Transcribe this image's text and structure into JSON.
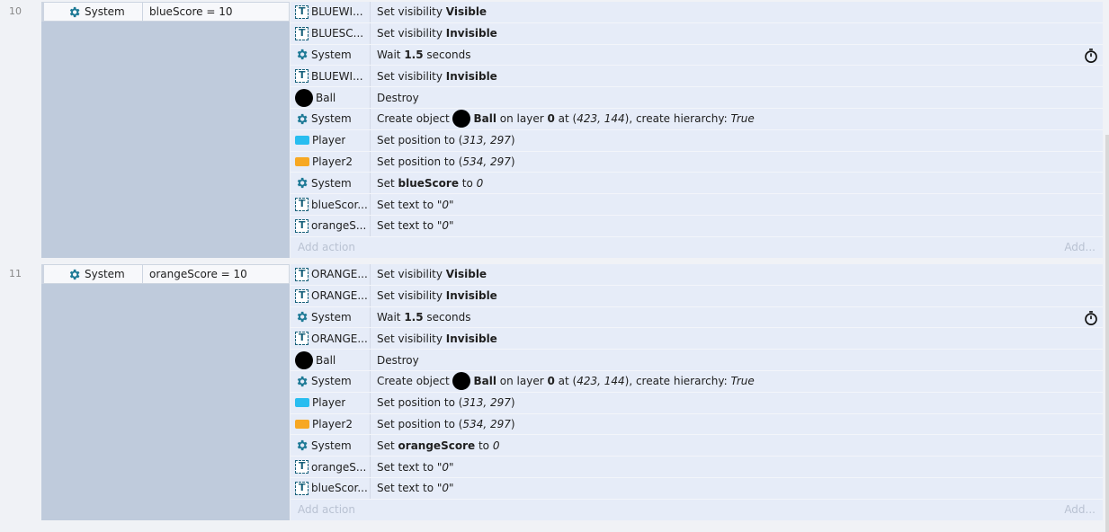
{
  "events": [
    {
      "number": "10",
      "condition": {
        "object": "System",
        "text": "blueScore = 10"
      },
      "actions": [
        {
          "icon": "text-icon",
          "object": "BLUEWI...",
          "parts": [
            {
              "t": "Set visibility "
            },
            {
              "t": "Visible",
              "b": true
            }
          ]
        },
        {
          "icon": "text-icon",
          "object": "BLUESC...",
          "parts": [
            {
              "t": "Set visibility "
            },
            {
              "t": "Invisible",
              "b": true
            }
          ]
        },
        {
          "icon": "gear-icon",
          "object": "System",
          "parts": [
            {
              "t": "Wait "
            },
            {
              "t": "1.5",
              "b": true
            },
            {
              "t": " seconds"
            }
          ],
          "timer": true
        },
        {
          "icon": "text-icon",
          "object": "BLUEWI...",
          "parts": [
            {
              "t": "Set visibility "
            },
            {
              "t": "Invisible",
              "b": true
            }
          ]
        },
        {
          "icon": "ball-icon",
          "object": "Ball",
          "parts": [
            {
              "t": "Destroy"
            }
          ]
        },
        {
          "icon": "gear-icon",
          "object": "System",
          "parts": [
            {
              "t": "Create object "
            },
            {
              "ball": true
            },
            {
              "t": "Ball",
              "b": true
            },
            {
              "t": " on layer "
            },
            {
              "t": "0",
              "b": true
            },
            {
              "t": " at ("
            },
            {
              "t": "423, 144",
              "i": true
            },
            {
              "t": "), create hierarchy: "
            },
            {
              "t": "True",
              "i": true
            }
          ]
        },
        {
          "icon": "player-icon",
          "object": "Player",
          "parts": [
            {
              "t": "Set position to ("
            },
            {
              "t": "313, 297",
              "i": true
            },
            {
              "t": ")"
            }
          ]
        },
        {
          "icon": "player2-icon",
          "object": "Player2",
          "parts": [
            {
              "t": "Set position to ("
            },
            {
              "t": "534, 297",
              "i": true
            },
            {
              "t": ")"
            }
          ]
        },
        {
          "icon": "gear-icon",
          "object": "System",
          "parts": [
            {
              "t": "Set "
            },
            {
              "t": "blueScore",
              "b": true
            },
            {
              "t": " to "
            },
            {
              "t": "0",
              "i": true
            }
          ]
        },
        {
          "icon": "text-icon",
          "object": "blueScor...",
          "parts": [
            {
              "t": "Set text to \""
            },
            {
              "t": "0",
              "i": true
            },
            {
              "t": "\""
            }
          ]
        },
        {
          "icon": "text-icon",
          "object": "orangeS...",
          "parts": [
            {
              "t": "Set text to \""
            },
            {
              "t": "0",
              "i": true
            },
            {
              "t": "\""
            }
          ]
        }
      ]
    },
    {
      "number": "11",
      "condition": {
        "object": "System",
        "text": "orangeScore = 10"
      },
      "actions": [
        {
          "icon": "text-icon",
          "object": "ORANGE...",
          "parts": [
            {
              "t": "Set visibility "
            },
            {
              "t": "Visible",
              "b": true
            }
          ]
        },
        {
          "icon": "text-icon",
          "object": "ORANGE...",
          "parts": [
            {
              "t": "Set visibility "
            },
            {
              "t": "Invisible",
              "b": true
            }
          ]
        },
        {
          "icon": "gear-icon",
          "object": "System",
          "parts": [
            {
              "t": "Wait "
            },
            {
              "t": "1.5",
              "b": true
            },
            {
              "t": " seconds"
            }
          ],
          "timer": true
        },
        {
          "icon": "text-icon",
          "object": "ORANGE...",
          "parts": [
            {
              "t": "Set visibility "
            },
            {
              "t": "Invisible",
              "b": true
            }
          ]
        },
        {
          "icon": "ball-icon",
          "object": "Ball",
          "parts": [
            {
              "t": "Destroy"
            }
          ]
        },
        {
          "icon": "gear-icon",
          "object": "System",
          "parts": [
            {
              "t": "Create object "
            },
            {
              "ball": true
            },
            {
              "t": "Ball",
              "b": true
            },
            {
              "t": " on layer "
            },
            {
              "t": "0",
              "b": true
            },
            {
              "t": " at ("
            },
            {
              "t": "423, 144",
              "i": true
            },
            {
              "t": "), create hierarchy: "
            },
            {
              "t": "True",
              "i": true
            }
          ]
        },
        {
          "icon": "player-icon",
          "object": "Player",
          "parts": [
            {
              "t": "Set position to ("
            },
            {
              "t": "313, 297",
              "i": true
            },
            {
              "t": ")"
            }
          ]
        },
        {
          "icon": "player2-icon",
          "object": "Player2",
          "parts": [
            {
              "t": "Set position to ("
            },
            {
              "t": "534, 297",
              "i": true
            },
            {
              "t": ")"
            }
          ]
        },
        {
          "icon": "gear-icon",
          "object": "System",
          "parts": [
            {
              "t": "Set "
            },
            {
              "t": "orangeScore",
              "b": true
            },
            {
              "t": " to "
            },
            {
              "t": "0",
              "i": true
            }
          ]
        },
        {
          "icon": "text-icon",
          "object": "orangeS...",
          "parts": [
            {
              "t": "Set text to \""
            },
            {
              "t": "0",
              "i": true
            },
            {
              "t": "\""
            }
          ]
        },
        {
          "icon": "text-icon",
          "object": "blueScor...",
          "parts": [
            {
              "t": "Set text to \""
            },
            {
              "t": "0",
              "i": true
            },
            {
              "t": "\""
            }
          ]
        }
      ]
    }
  ],
  "add_action_label": "Add action",
  "add_more_label": "Add...",
  "colors": {
    "gear": "#1e7a96",
    "text_icon": "#17607a",
    "player": "#28bdf0",
    "player2": "#f7a823",
    "action_bg": "#e6ecf8",
    "condition_bg": "#bfcbdc"
  }
}
